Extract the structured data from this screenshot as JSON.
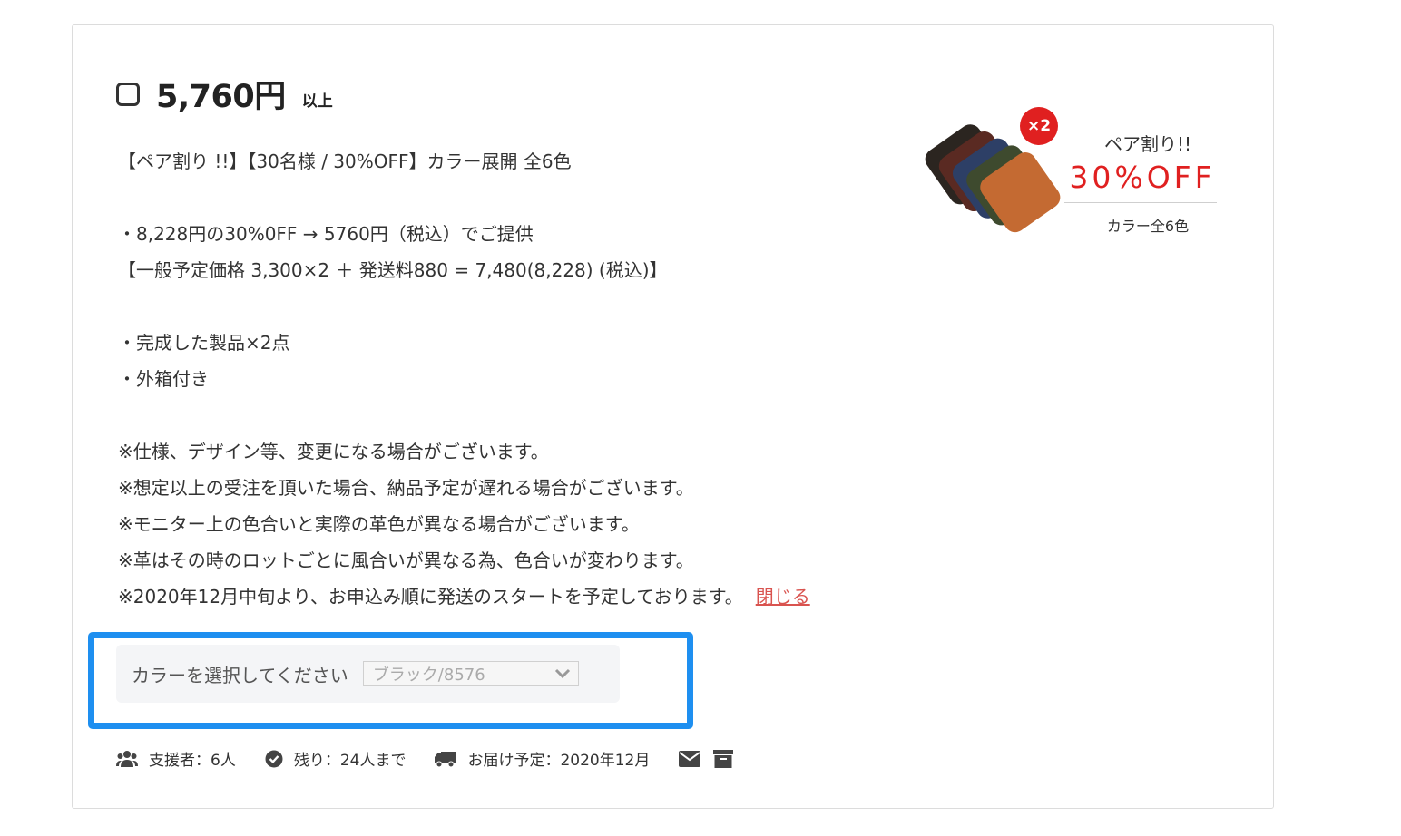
{
  "reward": {
    "price": "5,760円",
    "price_suffix": "以上",
    "description": {
      "headline": "【ペア割り !!】【30名様 / 30%OFF】カラー展開 全6色",
      "offer_line": "・8,228円の30%0FF → 5760円（税込）でご提供",
      "price_breakdown": "【一般予定価格 3,300×2 ＋ 発送料880 = 7,480(8,228) (税込)】",
      "items": [
        "・完成した製品×2点",
        "・外箱付き"
      ],
      "notes": [
        "※仕様、デザイン等、変更になる場合がございます。",
        "※想定以上の受注を頂いた場合、納品予定が遅れる場合がございます。",
        "※モニター上の色合いと実際の革色が異なる場合がございます。",
        "※革はその時のロットごとに風合いが異なる為、色合いが変わります。",
        "※2020年12月中旬より、お申込み順に発送のスタートを予定しております。"
      ],
      "close_link": "閉じる"
    },
    "promo_image": {
      "badge": "×2",
      "title": "ペア割り!!",
      "discount": "30%OFF",
      "subtitle": "カラー全6色",
      "wallet_colors": [
        "#2b2520",
        "#5a2a22",
        "#2d3f66",
        "#3e4a2e",
        "#c46a32"
      ]
    },
    "color_select": {
      "label": "カラーを選択してください",
      "selected": "ブラック/8576"
    },
    "stats": {
      "backers": "支援者：6人",
      "remaining": "残り：24人まで",
      "delivery": "お届け予定：2020年12月"
    }
  },
  "colors": {
    "accent_link": "#d9534f",
    "highlight_border": "#1e8ff0",
    "promo_red": "#e02020"
  }
}
